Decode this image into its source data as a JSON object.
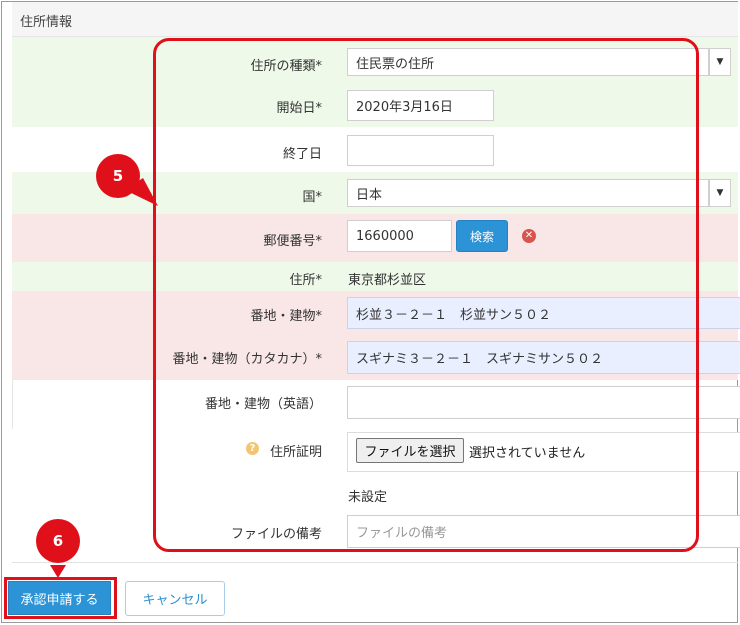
{
  "section": {
    "title": "住所情報"
  },
  "form": {
    "address_type": {
      "label": "住所の種類*",
      "value": "住民票の住所"
    },
    "start_date": {
      "label": "開始日*",
      "value": "2020年3月16日"
    },
    "end_date": {
      "label": "終了日",
      "value": ""
    },
    "country": {
      "label": "国*",
      "value": "日本"
    },
    "postal": {
      "label": "郵便番号*",
      "value": "1660000",
      "search_label": "検索"
    },
    "address": {
      "label": "住所*",
      "value": "東京都杉並区"
    },
    "street": {
      "label": "番地・建物*",
      "value": "杉並３－２－１　杉並サン５０２"
    },
    "street_kana": {
      "label": "番地・建物（カタカナ）*",
      "value": "スギナミ３－２－１　スギナミサン５０２"
    },
    "street_en": {
      "label": "番地・建物（英語）",
      "value": ""
    },
    "proof": {
      "label": "住所証明",
      "file_button": "ファイルを選択",
      "file_status": "選択されていません",
      "status": "未設定"
    },
    "file_note": {
      "label": "ファイルの備考",
      "placeholder": "ファイルの備考"
    }
  },
  "actions": {
    "submit_label": "承認申請する",
    "cancel_label": "キャンセル"
  },
  "annotations": {
    "step5": "5",
    "step6": "6"
  },
  "colors": {
    "accent": "#2b93d6",
    "highlight": "#e0101a",
    "row_green": "#eef9ea",
    "row_pink": "#f9e7e7"
  }
}
